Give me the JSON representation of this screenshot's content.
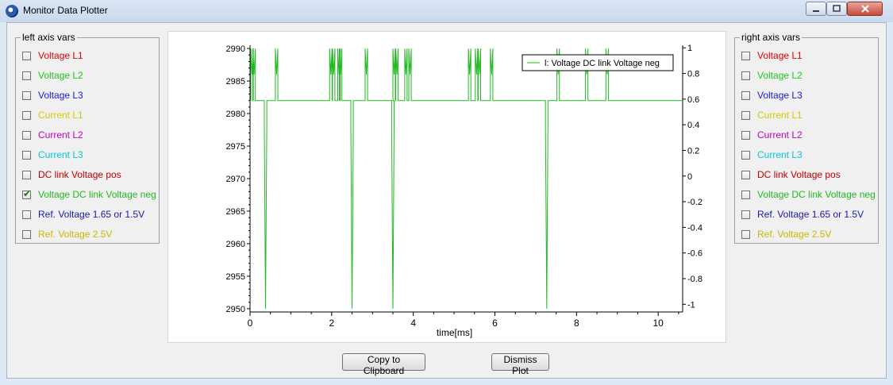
{
  "window": {
    "title": "Monitor Data Plotter",
    "controls": [
      "minimize-icon",
      "maximize-icon",
      "close-icon"
    ]
  },
  "left_panel": {
    "title": "left axis vars",
    "items": [
      {
        "label": "Voltage L1",
        "color": "#e00000",
        "checked": false
      },
      {
        "label": "Voltage L2",
        "color": "#22c522",
        "checked": false
      },
      {
        "label": "Voltage L3",
        "color": "#1a1ad8",
        "checked": false
      },
      {
        "label": "Current L1",
        "color": "#d8c800",
        "checked": false
      },
      {
        "label": "Current L2",
        "color": "#c000c0",
        "checked": false
      },
      {
        "label": "Current L3",
        "color": "#00c8d8",
        "checked": false
      },
      {
        "label": "DC link Voltage pos",
        "color": "#c00000",
        "checked": false
      },
      {
        "label": "Voltage DC link Voltage neg",
        "color": "#22b822",
        "checked": true
      },
      {
        "label": "Ref. Voltage 1.65 or 1.5V",
        "color": "#1a1aa8",
        "checked": false
      },
      {
        "label": "Ref. Voltage 2.5V",
        "color": "#c8b800",
        "checked": false
      }
    ]
  },
  "right_panel": {
    "title": "right axis vars",
    "items": [
      {
        "label": "Voltage L1",
        "color": "#e00000",
        "checked": false
      },
      {
        "label": "Voltage L2",
        "color": "#22c522",
        "checked": false
      },
      {
        "label": "Voltage L3",
        "color": "#1a1ad8",
        "checked": false
      },
      {
        "label": "Current L1",
        "color": "#d8c800",
        "checked": false
      },
      {
        "label": "Current L2",
        "color": "#c000c0",
        "checked": false
      },
      {
        "label": "Current L3",
        "color": "#00c8d8",
        "checked": false
      },
      {
        "label": "DC link Voltage pos",
        "color": "#c00000",
        "checked": false
      },
      {
        "label": "Voltage DC link Voltage neg",
        "color": "#22b822",
        "checked": false
      },
      {
        "label": "Ref. Voltage 1.65 or 1.5V",
        "color": "#1a1aa8",
        "checked": false
      },
      {
        "label": "Ref. Voltage 2.5V",
        "color": "#c8b800",
        "checked": false
      }
    ]
  },
  "chart_data": {
    "type": "line",
    "xlabel": "time[ms]",
    "ylabel": "",
    "xlim": [
      0,
      10.6
    ],
    "ylim": [
      2949.5,
      2990.5
    ],
    "y2lim": [
      -1.06,
      1.02
    ],
    "xticks": [
      0,
      2,
      4,
      6,
      8,
      10
    ],
    "yticks": [
      2950,
      2955,
      2960,
      2965,
      2970,
      2975,
      2980,
      2985,
      2990
    ],
    "y2ticks": [
      -1,
      -0.8,
      -0.6,
      -0.4,
      -0.2,
      0,
      0.2,
      0.4,
      0.6,
      0.8,
      1
    ],
    "grid": false,
    "legend_position": "top-right",
    "series": [
      {
        "name": "l:  Voltage DC link Voltage neg",
        "color": "#22b822",
        "axis": "left",
        "baseline": 2982,
        "spikes_up": [
          0.05,
          0.1,
          0.65,
          1.98,
          2.05,
          2.18,
          2.22,
          2.85,
          3.53,
          3.6,
          3.82,
          3.92,
          5.38,
          5.55,
          5.62,
          5.92,
          7.55,
          8.25,
          8.75
        ],
        "spikes_down": [
          0.38,
          2.5,
          3.5,
          7.27
        ]
      }
    ]
  },
  "buttons": {
    "copy": "Copy to Clipboard",
    "dismiss": "Dismiss Plot"
  }
}
